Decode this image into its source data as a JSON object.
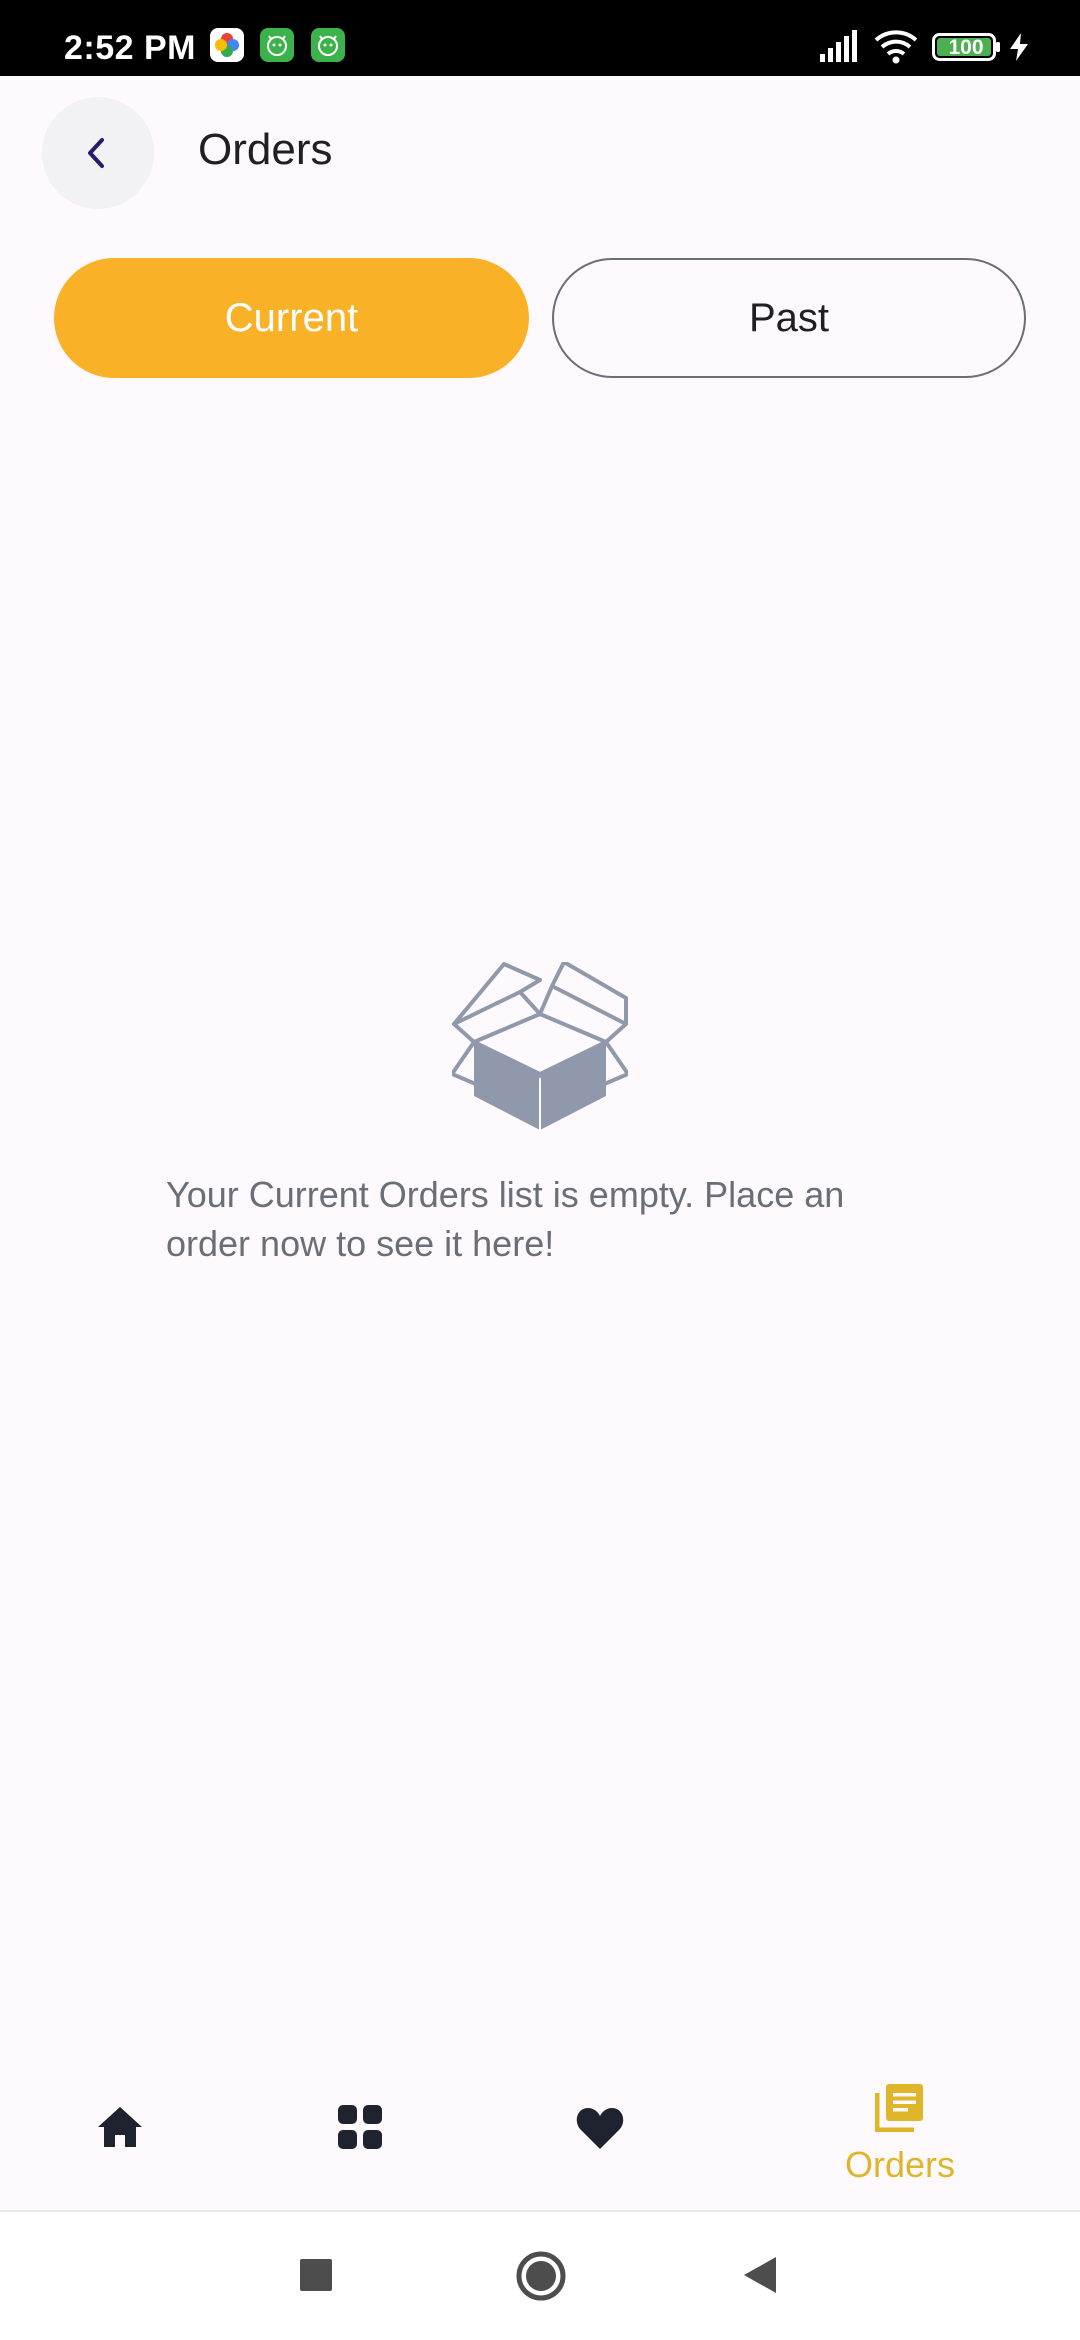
{
  "status_bar": {
    "time": "2:52 PM",
    "battery_level": "100",
    "icons": [
      "google-photos-icon",
      "android-app-icon",
      "android-app-icon",
      "signal-icon",
      "wifi-icon",
      "battery-icon",
      "charging-icon"
    ]
  },
  "header": {
    "back_icon": "chevron-left-icon",
    "title": "Orders"
  },
  "tabs": [
    {
      "label": "Current",
      "active": true
    },
    {
      "label": "Past",
      "active": false
    }
  ],
  "empty_state": {
    "icon": "open-box-icon",
    "message": "Your Current Orders list is empty. Place an order now to see it here!"
  },
  "bottom_nav": {
    "items": [
      {
        "icon": "home-icon",
        "label": "",
        "active": false
      },
      {
        "icon": "grid-icon",
        "label": "",
        "active": false
      },
      {
        "icon": "heart-icon",
        "label": "",
        "active": false
      },
      {
        "icon": "orders-icon",
        "label": "Orders",
        "active": true
      }
    ]
  },
  "system_nav": {
    "icons": [
      "recents-icon",
      "home-circle-icon",
      "back-triangle-icon"
    ]
  },
  "colors": {
    "accent": "#f9b228",
    "active_nav": "#dfb52a",
    "background": "#fdf9fc",
    "text_primary": "#1f1f24",
    "text_muted": "#6a6e78",
    "icon_dark": "#1f2330",
    "empty_icon": "#9099ab"
  }
}
